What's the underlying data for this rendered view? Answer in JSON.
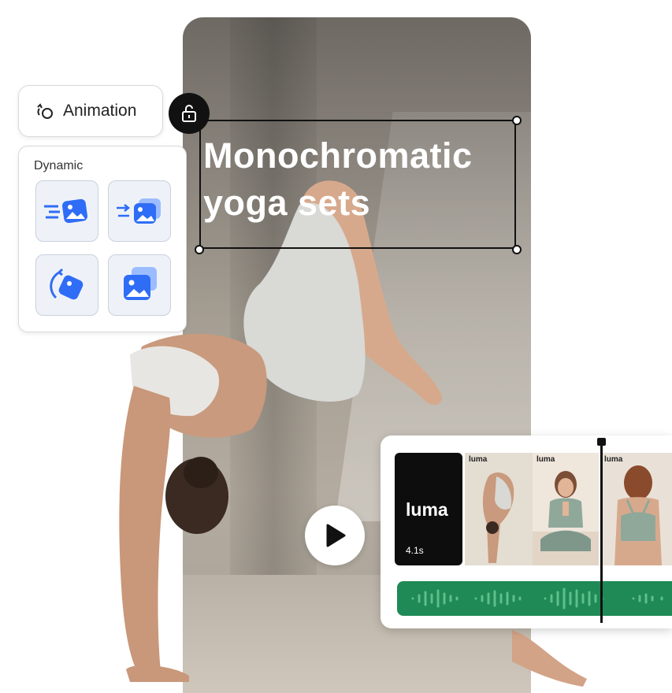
{
  "animation_panel": {
    "label": "Animation",
    "icon": "animation-icon"
  },
  "dynamic_panel": {
    "title": "Dynamic",
    "presets": [
      {
        "icon": "slide-in-image-icon"
      },
      {
        "icon": "push-stack-image-icon"
      },
      {
        "icon": "rotate-in-image-icon"
      },
      {
        "icon": "stacked-images-icon"
      }
    ]
  },
  "canvas": {
    "headline_line1": "Monochromatic",
    "headline_line2": "yoga sets"
  },
  "timeline": {
    "title_clip": {
      "logo": "luma",
      "duration": "4.1s"
    },
    "thumbnails": [
      {
        "tag": "luma"
      },
      {
        "tag": "luma"
      },
      {
        "tag": "luma"
      }
    ]
  },
  "colors": {
    "accent_blue": "#2f6df6",
    "audio_green": "#1f8a56",
    "selection": "#111111"
  }
}
